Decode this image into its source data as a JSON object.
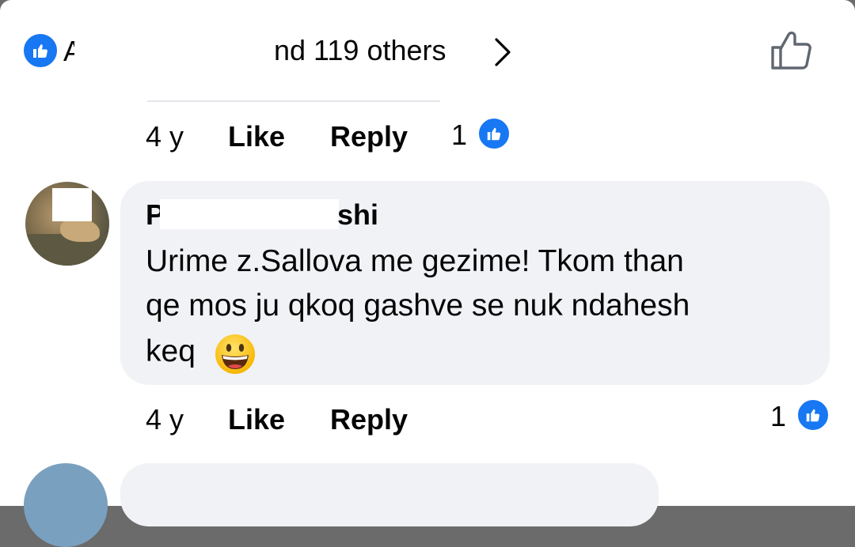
{
  "header": {
    "partial_name": "A",
    "likes_text": "nd 119 others",
    "icons": {
      "reaction": "like-reaction-icon",
      "chevron": "chevron-right-icon",
      "thumb": "thumbs-up-outline-icon"
    }
  },
  "first_comment_actions": {
    "time": "4 y",
    "like_label": "Like",
    "reply_label": "Reply",
    "reaction_count": "1"
  },
  "comment": {
    "author_prefix": "P",
    "author_suffix": "shi",
    "lines": [
      "Urime z.Sallova me gezime! Tkom than",
      "qe mos ju qkoq gashve se nuk ndahesh",
      "keq"
    ],
    "emoji_icon": "grinning-face-emoji-icon"
  },
  "second_comment_actions": {
    "time": "4 y",
    "like_label": "Like",
    "reply_label": "Reply",
    "reaction_count": "1"
  },
  "colors": {
    "accent": "#1877f2",
    "bubble": "#f0f2f5",
    "text": "#050505"
  }
}
